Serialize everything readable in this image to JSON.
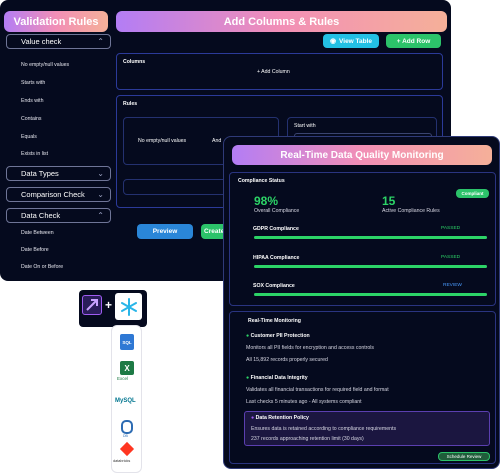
{
  "rules_panel": {
    "title": "Validation Rules",
    "value_check": "Value check",
    "value_items": [
      "No empty/null values",
      "Starts with",
      "Ends with",
      "Contains",
      "Equals",
      "Exists in list"
    ],
    "data_types": "Data Types",
    "comparison_check": "Comparison Check",
    "data_check": "Data Check",
    "data_items": [
      "Date Between",
      "Date Before",
      "Date On or Before"
    ]
  },
  "main_panel": {
    "title": "Add Columns & Rules",
    "view_table": "View Table",
    "add_row": "+ Add Row",
    "columns_label": "Columns",
    "add_column": "+ Add Column",
    "rules_label": "Rules",
    "rule_value": "No empty/null values",
    "rule_and": "And",
    "start_with": "Start with",
    "preview": "Preview",
    "create": "Create"
  },
  "monitor": {
    "title": "Real-Time Data Quality Monitoring",
    "compliance_status": "Compliance Status",
    "compliant_badge": "Compliant",
    "overall_value": "98%",
    "overall_label": "Overall Compliance",
    "active_value": "15",
    "active_label": "Active Compliance Rules",
    "items": [
      {
        "name": "GDPR Compliance",
        "status": "PASSED",
        "pct": 100
      },
      {
        "name": "HIPAA Compliance",
        "status": "PASSED",
        "pct": 100
      },
      {
        "name": "SOX Compliance",
        "status": "REVIEW",
        "pct": 100
      }
    ],
    "rt_title": "Real-Time Monitoring",
    "cards": [
      {
        "title": "Customer PII Protection",
        "l1": "Monitors all PII fields for encryption and access controls",
        "l2": "All 15,892 records properly secured"
      },
      {
        "title": "Financial Data Integrity",
        "l1": "Validates all financial transactions for required field and format",
        "l2": "Last checks 5 minutes ago - All systems compliant"
      },
      {
        "title": "Data Retention Policy",
        "l1": "Ensures data is retained according to compliance requirements",
        "l2": "237 records approaching retention limit (30 days)"
      }
    ],
    "schedule_review": "Schedule Review"
  },
  "integrations": {
    "labels": [
      "SQL",
      "Excel",
      "MySQL",
      "DB",
      "databricks"
    ]
  },
  "colors": {
    "accent_green": "#2cd467",
    "accent_blue": "#2a86d8",
    "cyan": "#22c3e6",
    "purple": "#a05cf2"
  }
}
